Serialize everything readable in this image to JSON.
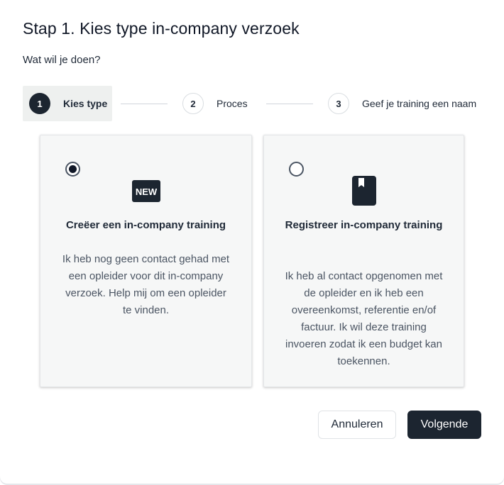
{
  "modal": {
    "title": "Stap 1. Kies type in-company verzoek",
    "subtitle": "Wat wil je doen?"
  },
  "stepper": {
    "steps": [
      {
        "number": "1",
        "label": "Kies type",
        "state": "active"
      },
      {
        "number": "2",
        "label": "Proces",
        "state": "inactive"
      },
      {
        "number": "3",
        "label": "Geef je training een naam",
        "state": "inactive"
      }
    ]
  },
  "options": [
    {
      "selected": true,
      "icon": "new-badge-icon",
      "icon_text": "NEW",
      "title": "Creëer een in-company training",
      "description": "Ik heb nog geen contact gehad met een opleider voor dit in-company verzoek. Help mij om een opleider te vinden."
    },
    {
      "selected": false,
      "icon": "bookmark-book-icon",
      "title": "Registreer in-company training",
      "description": "Ik heb al contact opgenomen met de opleider en ik heb een overeenkomst, referentie en/of factuur. Ik wil deze training invoeren zodat ik een budget kan toekennen."
    }
  ],
  "actions": {
    "cancel_label": "Annuleren",
    "next_label": "Volgende"
  },
  "colors": {
    "primary": "#1c2530",
    "card_bg": "#f6f7f7",
    "step_active_bg": "#eef0ef"
  }
}
